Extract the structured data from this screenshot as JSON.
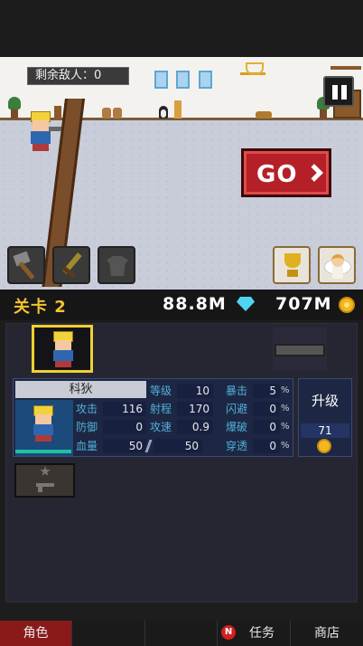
{
  "scene": {
    "enemy_counter": "剩余敌人：0",
    "go_label": "GO"
  },
  "status": {
    "level": "关卡 2",
    "gems": "88.8M",
    "gold": "707M"
  },
  "character": {
    "name": "科狄",
    "stats": [
      {
        "label": "攻击",
        "value": "116"
      },
      {
        "label": "防御",
        "value": "0"
      },
      {
        "label": "血量",
        "value": "50"
      }
    ],
    "hp_max": "50",
    "stats_mid": [
      {
        "label": "等级",
        "value": "10"
      },
      {
        "label": "射程",
        "value": "170"
      },
      {
        "label": "攻速",
        "value": "0.9"
      }
    ],
    "stats_right": [
      {
        "label": "暴击",
        "value": "5",
        "unit": "%"
      },
      {
        "label": "闪避",
        "value": "0",
        "unit": "%"
      },
      {
        "label": "爆破",
        "value": "0",
        "unit": "%"
      },
      {
        "label": "穿透",
        "value": "0",
        "unit": "%"
      }
    ],
    "upgrade_label": "升级",
    "upgrade_cost": "71"
  },
  "nav": {
    "items": [
      "角色",
      "",
      "",
      "任务",
      "商店"
    ],
    "badge": "N"
  },
  "icons": {
    "left_buttons": [
      "hammer-icon",
      "sword-icon",
      "armor-icon"
    ],
    "right_buttons": [
      "trophy-icon",
      "angel-icon"
    ]
  }
}
